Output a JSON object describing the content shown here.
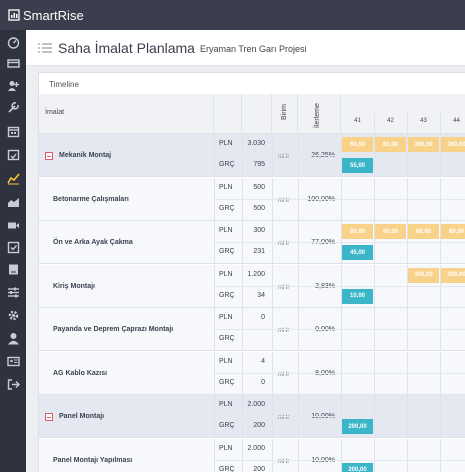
{
  "brand": "SmartRise",
  "header": {
    "title": "Saha İmalat Planlama",
    "subtitle": "Eryaman Tren Garı Projesi"
  },
  "card": {
    "title": "Timeline"
  },
  "columns": {
    "imalat": "İmalat",
    "birim": "Birim",
    "ilerleme": "İlerleme"
  },
  "weeks": [
    "41",
    "42",
    "43",
    "44"
  ],
  "colors": {
    "plan": "#f9d28a",
    "actual": "#3bb5c8",
    "toggle": "#e05a6a",
    "accent": "#f6c83a"
  },
  "sidebar_icons": [
    "dashboard-icon",
    "credit-card-icon",
    "add-user-icon",
    "wrench-icon",
    "calendar-icon",
    "calendar-check-icon",
    "line-chart-icon",
    "area-chart-icon",
    "video-icon",
    "check-square-icon",
    "book-icon",
    "sliders-icon",
    "gear-icon",
    "user-icon",
    "id-card-icon",
    "sign-out-icon"
  ],
  "rows": [
    {
      "name": "Mekanik Montaj",
      "group": true,
      "pln_label": "PLN",
      "grc_label": "GRÇ",
      "pln": "3.030",
      "grc": "795",
      "unit": "mHr",
      "progress": "26,25%",
      "plan_bars": [
        "60,00",
        "60,00",
        "360,00",
        "360,00"
      ],
      "actual_bars": [
        "55,00"
      ]
    },
    {
      "name": "Betonarme Çalışmaları",
      "group": false,
      "pln_label": "PLN",
      "grc_label": "GRÇ",
      "pln": "500",
      "grc": "500",
      "unit": "mHr",
      "progress": "100,00%",
      "plan_bars": [],
      "actual_bars": []
    },
    {
      "name": "Ön ve Arka Ayak Çakma",
      "group": false,
      "pln_label": "PLN",
      "grc_label": "GRÇ",
      "pln": "300",
      "grc": "231",
      "unit": "mHr",
      "progress": "77,00%",
      "plan_bars": [
        "60,00",
        "60,00",
        "60,00",
        "60,00"
      ],
      "actual_bars": [
        "45,00"
      ]
    },
    {
      "name": "Kiriş Montajı",
      "group": false,
      "pln_label": "PLN",
      "grc_label": "GRÇ",
      "pln": "1.200",
      "grc": "34",
      "unit": "mHr",
      "progress": "2,83%",
      "plan_bars": [
        "300,00",
        "300,00"
      ],
      "actual_bars": [
        "10,00"
      ]
    },
    {
      "name": "Payanda ve Deprem Çaprazı Montajı",
      "group": false,
      "pln_label": "PLN",
      "grc_label": "GRÇ",
      "pln": "0",
      "grc": "",
      "unit": "mHr",
      "progress": "0,00%",
      "plan_bars": [],
      "actual_bars": []
    },
    {
      "name": "AG Kablo Kazısı",
      "group": false,
      "pln_label": "PLN",
      "grc_label": "GRÇ",
      "pln": "4",
      "grc": "0",
      "unit": "mHr",
      "progress": "8,00%",
      "plan_bars": [],
      "actual_bars": []
    },
    {
      "name": "Panel Montajı",
      "group": true,
      "pln_label": "PLN",
      "grc_label": "GRÇ",
      "pln": "2.000",
      "grc": "200",
      "unit": "mHr",
      "progress": "10,00%",
      "plan_bars": [],
      "actual_bars": [
        "200,00"
      ]
    },
    {
      "name": "Panel Montajı Yapılması",
      "group": false,
      "pln_label": "PLN",
      "grc_label": "GRÇ",
      "pln": "2.000",
      "grc": "200",
      "unit": "mHr",
      "progress": "10,00%",
      "plan_bars": [],
      "actual_bars": [
        "200,00"
      ]
    }
  ]
}
